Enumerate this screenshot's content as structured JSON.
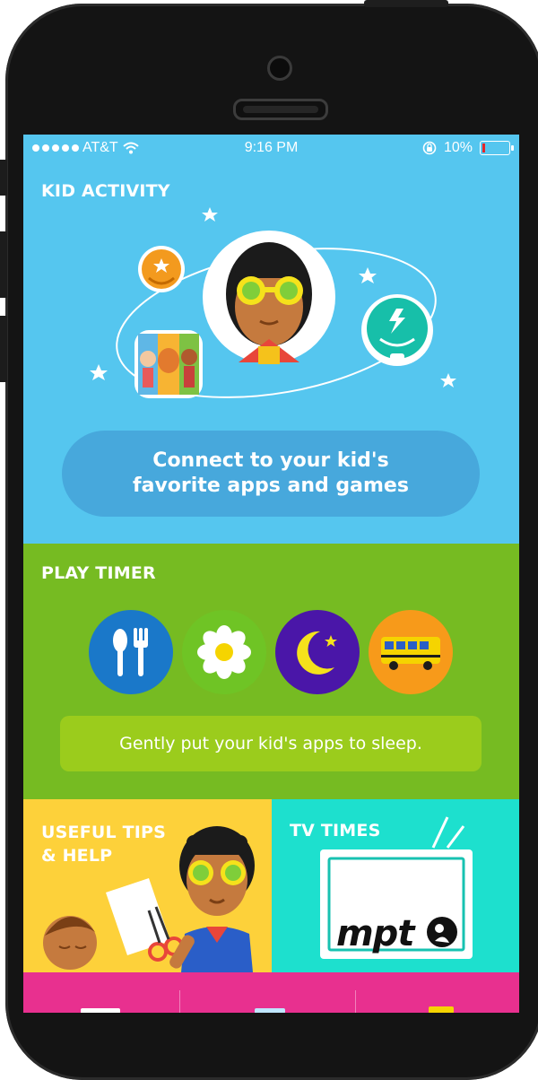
{
  "status_bar": {
    "carrier": "AT&T",
    "time": "9:16 PM",
    "battery_percent": "10%"
  },
  "kid_activity": {
    "title": "KID ACTIVITY",
    "connect_button": "Connect to your kid's favorite apps and games"
  },
  "play_timer": {
    "title": "PLAY TIMER",
    "sleep_text": "Gently put your kid's apps to sleep.",
    "icons": [
      "fork-knife-icon",
      "flower-icon",
      "moon-star-icon",
      "school-bus-icon"
    ]
  },
  "tips": {
    "title_line1": "USEFUL TIPS",
    "title_line2": "& HELP"
  },
  "tv_times": {
    "title": "TV TIMES",
    "logo_text": "mpt"
  },
  "colors": {
    "kid_activity_bg": "#55c6ef",
    "play_timer_bg": "#76bb22",
    "tips_bg": "#fdd13a",
    "tv_bg": "#1de0ce",
    "bottom_bg": "#e8308f"
  }
}
